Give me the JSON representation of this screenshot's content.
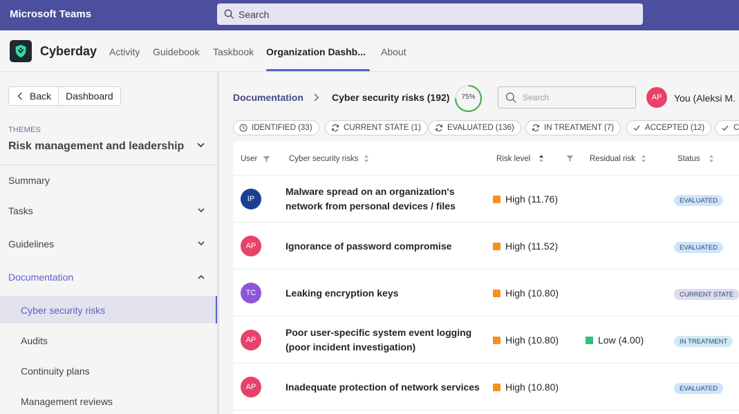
{
  "teams": {
    "title": "Microsoft Teams",
    "search_placeholder": "Search"
  },
  "app": {
    "name": "Cyberday",
    "tabs": [
      {
        "label": "Activity"
      },
      {
        "label": "Guidebook"
      },
      {
        "label": "Taskbook"
      },
      {
        "label": "Organization Dashb..."
      },
      {
        "label": "About"
      }
    ],
    "active_tab": "Organization Dashb..."
  },
  "sidebar": {
    "back_label": "Back",
    "dashboard_label": "Dashboard",
    "themes_label": "THEMES",
    "themes_value": "Risk management and leadership",
    "items": [
      {
        "label": "Summary"
      },
      {
        "label": "Tasks"
      },
      {
        "label": "Guidelines"
      },
      {
        "label": "Documentation"
      }
    ],
    "sub_items": [
      {
        "label": "Cyber security risks"
      },
      {
        "label": "Audits"
      },
      {
        "label": "Continuity plans"
      },
      {
        "label": "Management reviews"
      }
    ]
  },
  "main": {
    "breadcrumb_root": "Documentation",
    "breadcrumb_current": "Cyber security risks (192)",
    "progress_value": 75,
    "progress_label": "75%",
    "search_placeholder": "Search",
    "user_initials": "AP",
    "user_name": "You (Aleksi M. P",
    "chips": [
      {
        "label": "IDENTIFIED (33)",
        "icon": "clock-icon"
      },
      {
        "label": "CURRENT STATE (1)",
        "icon": "refresh-icon"
      },
      {
        "label": "EVALUATED (136)",
        "icon": "refresh-icon"
      },
      {
        "label": "IN TREATMENT (7)",
        "icon": "refresh-icon"
      },
      {
        "label": "ACCEPTED (12)",
        "icon": "check-icon"
      },
      {
        "label": "C",
        "icon": "check-icon"
      }
    ],
    "columns": {
      "user": "User",
      "risk": "Cyber security risks",
      "level": "Risk level",
      "residual": "Residual risk",
      "status": "Status"
    },
    "rows": [
      {
        "initials": "IP",
        "avatar_color": "#1c3f94",
        "title": "Malware spread on an organization's network from personal devices / files",
        "risk_level": "High (11.76)",
        "residual": "",
        "status": "EVALUATED",
        "status_color": "#cfe4fa"
      },
      {
        "initials": "AP",
        "avatar_color": "#e8426a",
        "title": "Ignorance of password compromise",
        "risk_level": "High (11.52)",
        "residual": "",
        "status": "EVALUATED",
        "status_color": "#cfe4fa"
      },
      {
        "initials": "TC",
        "avatar_color": "#8e56d6",
        "title": "Leaking encryption keys",
        "risk_level": "High (10.80)",
        "residual": "",
        "status": "CURRENT STATE",
        "status_color": "#dcdcec"
      },
      {
        "initials": "AP",
        "avatar_color": "#e8426a",
        "title": "Poor user-specific system event logging (poor incident investigation)",
        "risk_level": "High (10.80)",
        "residual": "Low (4.00)",
        "status": "IN TREATMENT",
        "status_color": "#cfe9f5"
      },
      {
        "initials": "AP",
        "avatar_color": "#e8426a",
        "title": "Inadequate protection of network services",
        "risk_level": "High (10.80)",
        "residual": "",
        "status": "EVALUATED",
        "status_color": "#cfe4fa"
      }
    ],
    "colors": {
      "high": "#f7901e",
      "low": "#2ec27e",
      "accent": "#5b5fc7"
    }
  }
}
